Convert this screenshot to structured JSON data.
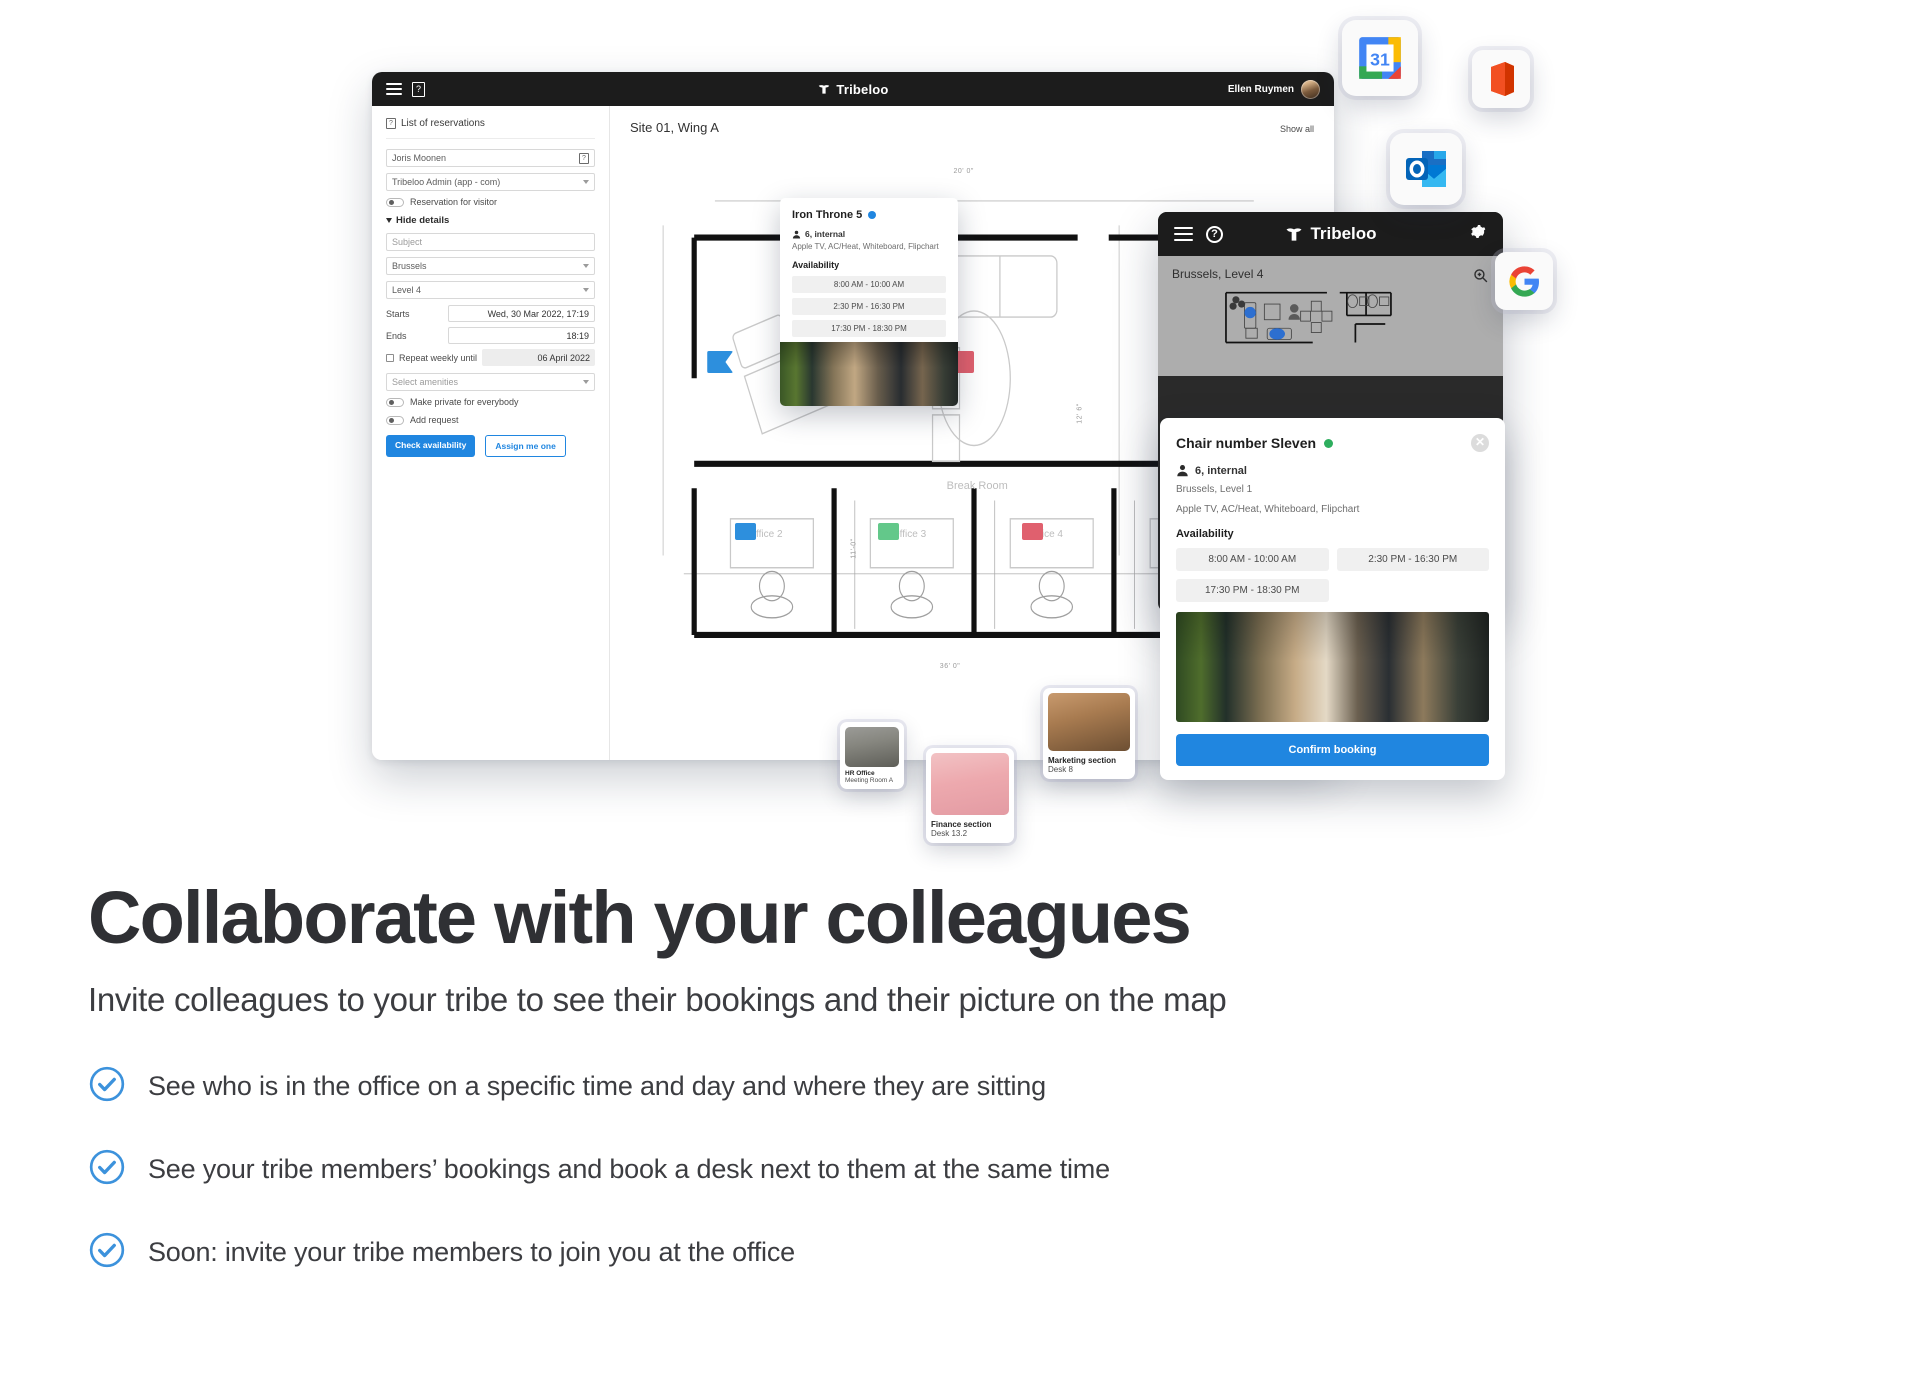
{
  "hero": {
    "desktop_window": {
      "topbar": {
        "menu_icon": "hamburger-icon",
        "help_icon": "help-box-icon",
        "brand": "Tribeloo",
        "user_name": "Ellen Ruymen",
        "avatar": "user-avatar"
      },
      "reservation_panel": {
        "header": "List of reservations",
        "person_value": "Joris Moonen",
        "person_icon": "help-box-icon",
        "account_value": "Tribeloo Admin (app - com)",
        "visitor_toggle_label": "Reservation for visitor",
        "hide_details_label": "Hide details",
        "subject_placeholder": "Subject",
        "site_value": "Brussels",
        "level_value": "Level 4",
        "starts_label": "Starts",
        "starts_value": "Wed, 30 Mar 2022, 17:19",
        "ends_label": "Ends",
        "ends_value": "18:19",
        "repeat_label": "Repeat weekly until",
        "repeat_value": "06 April 2022",
        "amenities_placeholder": "Select amenities",
        "private_toggle_label": "Make private for everybody",
        "request_toggle_label": "Add request",
        "check_availability_label": "Check availability",
        "assign_me_one_label": "Assign me one"
      },
      "map": {
        "title": "Site 01, Wing A",
        "show_all_label": "Show all",
        "room_labels": [
          "Break Room",
          "Office 2",
          "Office 3",
          "Office 4"
        ],
        "dimension_labels": [
          "20' 0\"",
          "12' 6\"",
          "36' 0\"",
          "11'-0\""
        ]
      }
    },
    "iron_throne_popup": {
      "title": "Iron Throne 5",
      "status_color": "#2086e0",
      "capacity": "6, internal",
      "amenities": "Apple TV, AC/Heat, Whiteboard, Flipchart",
      "availability_label": "Availability",
      "slots": [
        "8:00 AM - 10:00 AM",
        "2:30 PM - 16:30 PM",
        "17:30 PM - 18:30 PM"
      ]
    },
    "tablet_window": {
      "topbar": {
        "menu_icon": "hamburger-icon",
        "help_icon": "help-circle-icon",
        "brand": "Tribeloo",
        "settings_icon": "gear-icon"
      },
      "map_title": "Brussels, Level 4",
      "zoom_icon": "zoom-in-icon"
    },
    "chair_popup": {
      "title": "Chair number Sleven",
      "status_color": "#2eae5e",
      "close_icon": "close-icon",
      "capacity": "6, internal",
      "location": "Brussels, Level 1",
      "amenities": "Apple TV, AC/Heat, Whiteboard, Flipchart",
      "availability_label": "Availability",
      "slots": [
        "8:00 AM - 10:00 AM",
        "2:30 PM - 16:30 PM",
        "17:30 PM - 18:30 PM"
      ],
      "confirm_label": "Confirm booking"
    },
    "people_pins": [
      {
        "name": "HR Office",
        "desk": "Meeting Room A"
      },
      {
        "name": "Finance section",
        "desk": "Desk 13.2"
      },
      {
        "name": "Marketing section",
        "desk": "Desk 8"
      }
    ],
    "app_icons": [
      {
        "name": "google-calendar-icon",
        "day": "31"
      },
      {
        "name": "microsoft-office-icon"
      },
      {
        "name": "microsoft-outlook-icon"
      },
      {
        "name": "google-icon"
      }
    ]
  },
  "content": {
    "headline": "Collaborate with your colleagues",
    "subhead": "Invite colleagues to your tribe to see their bookings and their picture on the map",
    "bullets": [
      "See who is in the office on a specific time and day and where they are sitting",
      "See your tribe members’ bookings and book a desk next to them at the same time",
      "Soon: invite your tribe members to join you at the office"
    ]
  },
  "colors": {
    "accent_blue": "#2086e0",
    "check_blue": "#3c92dc",
    "dark_bar": "#1c1c1c",
    "heading": "#2f3034",
    "green_status": "#2eae5e",
    "marker_blue": "#2d8fdd",
    "marker_green": "#63c88a",
    "marker_red": "#e0606e"
  }
}
